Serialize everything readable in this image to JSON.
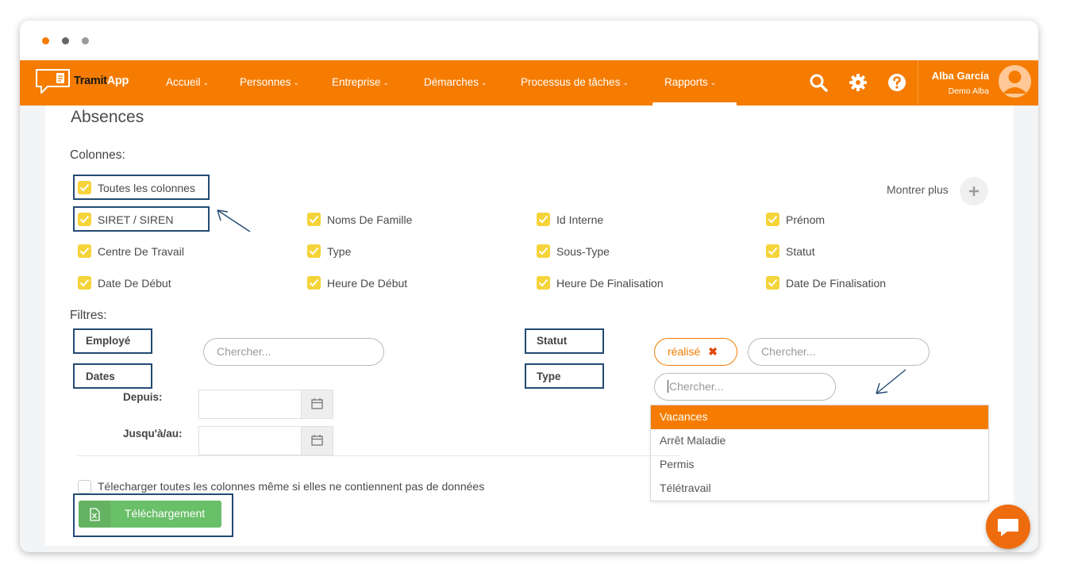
{
  "window": {
    "traffic_lights": [
      "#f57c00",
      "#666666",
      "#999999"
    ]
  },
  "navbar": {
    "brand_part1": "Tramit",
    "brand_part2": "App",
    "items": [
      {
        "label": "Accueil"
      },
      {
        "label": "Personnes"
      },
      {
        "label": "Entreprise"
      },
      {
        "label": "Démarches"
      },
      {
        "label": "Processus de tâches"
      },
      {
        "label": "Rapports"
      }
    ],
    "active_item": "Rapports",
    "icons": [
      "search-icon",
      "gear-icon",
      "help-icon"
    ],
    "user_name": "Alba García",
    "user_company": "Demo Alba",
    "accent": "#f57c00"
  },
  "page": {
    "title": "Absences",
    "columns_label": "Colonnes:",
    "show_more_label": "Montrer plus",
    "all_columns_label": "Toutes les colonnes",
    "columns": [
      [
        "SIRET / SIREN",
        "Noms De Famille",
        "Id Interne",
        "Prénom"
      ],
      [
        "Centre De Travail",
        "Type",
        "Sous-Type",
        "Statut"
      ],
      [
        "Date De Début",
        "Heure De Début",
        "Heure De Finalisation",
        "Date De Finalisation"
      ]
    ],
    "filters_label": "Filtres:",
    "filters": {
      "employe_label": "Employé",
      "employe_placeholder": "Chercher...",
      "dates_label": "Dates",
      "since_label": "Depuis:",
      "until_label": "Jusqu'à/au:",
      "statut_label": "Statut",
      "statut_tag": "réalisé",
      "statut_placeholder": "Chercher...",
      "type_label": "Type",
      "type_placeholder": "Chercher...",
      "type_options": [
        "Vacances",
        "Arrêt Maladie",
        "Permis",
        "Télétravail"
      ],
      "type_highlighted": "Vacances"
    },
    "download_all_label": "Télecharger toutes les colonnes même si elles ne contiennent pas de données",
    "download_button": "Téléchargement"
  },
  "colors": {
    "checkbox": "#f5d43a",
    "highlight_box": "#234a73",
    "download_green": "#6abf69"
  }
}
